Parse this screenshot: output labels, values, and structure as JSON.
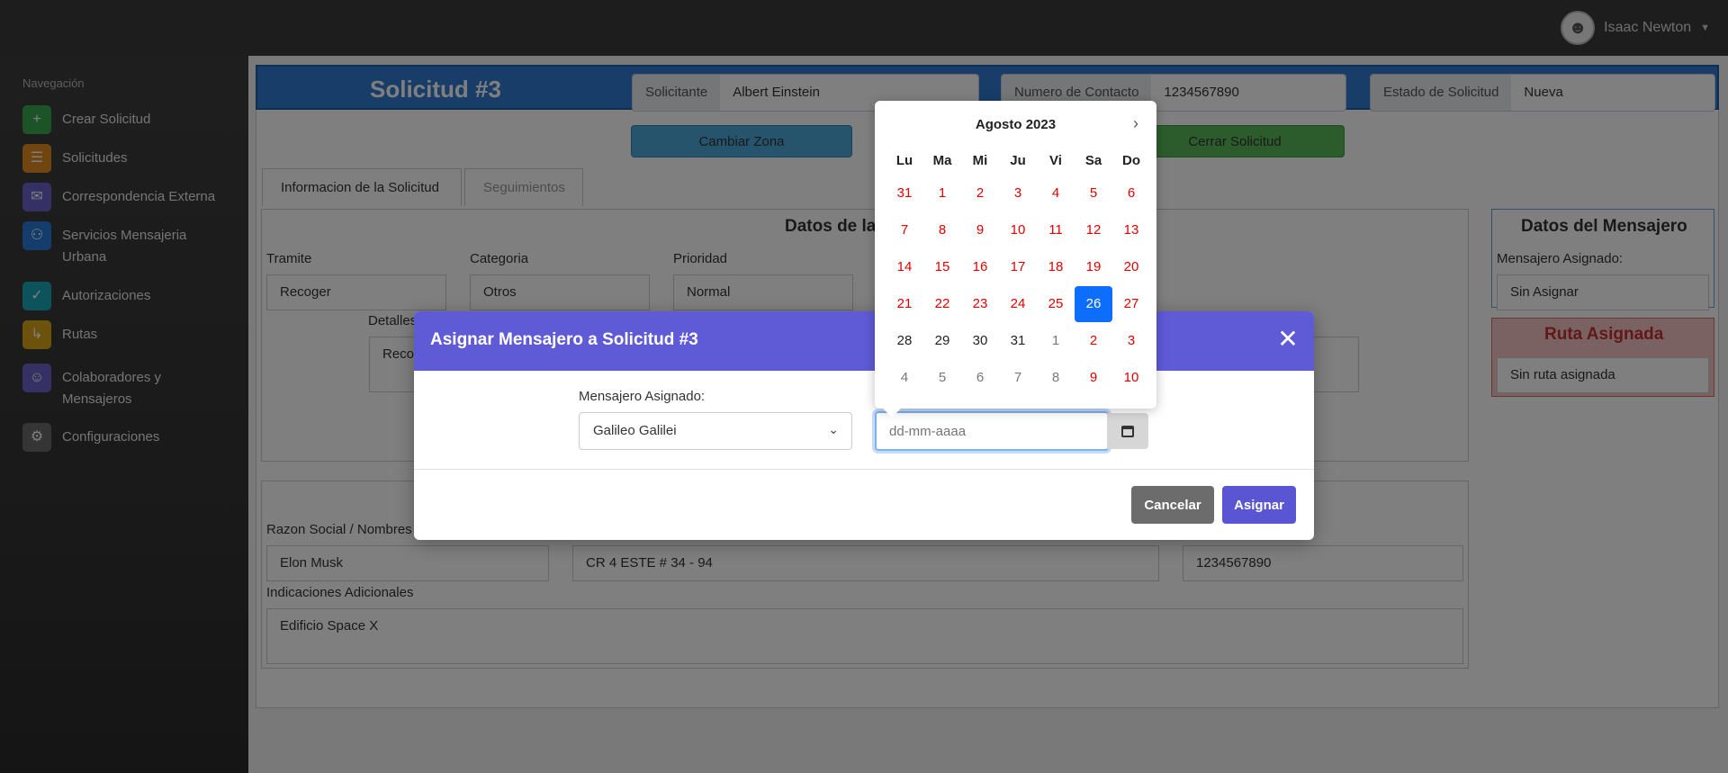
{
  "header": {
    "user_name": "Isaac Newton"
  },
  "sidebar": {
    "title": "Navegación",
    "items": [
      {
        "label": "Crear Solicitud",
        "icon": "document-plus-icon",
        "color": "#38a850"
      },
      {
        "label": "Solicitudes",
        "icon": "list-icon",
        "color": "#e08a1e"
      },
      {
        "label": "Correspondencia Externa",
        "icon": "envelope-icon",
        "color": "#6a63c9"
      },
      {
        "label": "Servicios Mensajeria Urbana",
        "icon": "motorcycle-icon",
        "color": "#2a7bd8"
      },
      {
        "label": "Autorizaciones",
        "icon": "clipboard-check-icon",
        "color": "#1aa6b8"
      },
      {
        "label": "Rutas",
        "icon": "route-icon",
        "color": "#d9a515"
      },
      {
        "label": "Colaboradores y Mensajeros",
        "icon": "users-icon",
        "color": "#6a63c9"
      },
      {
        "label": "Configuraciones",
        "icon": "gear-icon",
        "color": "#6b6b6b"
      }
    ]
  },
  "request": {
    "title": "Solicitud #3",
    "requester_label": "Solicitante",
    "requester_value": "Albert Einstein",
    "contact_label": "Numero de Contacto",
    "contact_value": "1234567890",
    "status_label": "Estado de Solicitud",
    "status_value": "Nueva",
    "change_zone": "Cambiar Zona",
    "close_request": "Cerrar Solicitud",
    "tabs": [
      "Informacion de la Solicitud",
      "Seguimientos"
    ],
    "data_title": "Datos de la",
    "tramite_label": "Tramite",
    "tramite_value": "Recoger",
    "categoria_label": "Categoria",
    "categoria_value": "Otros",
    "prioridad_label": "Prioridad",
    "prioridad_value": "Normal",
    "detalles_label": "Detalles",
    "detalles_value": "Reco",
    "razon_label": "Razon Social / Nombres",
    "razon_value": "Elon Musk",
    "direccion_value": "CR 4 ESTE # 34 - 94",
    "telefono_value": "1234567890",
    "indicaciones_label": "Indicaciones Adicionales",
    "indicaciones_value": "Edificio Space X",
    "courier_title": "Datos del Mensajero",
    "courier_label": "Mensajero Asignado:",
    "courier_value": "Sin Asignar",
    "route_title": "Ruta Asignada",
    "route_value": "Sin ruta asignada"
  },
  "modal": {
    "title": "Asignar Mensajero a Solicitud #3",
    "courier_label": "Mensajero Asignado:",
    "courier_selected": "Galileo Galilei",
    "date_placeholder": "dd-mm-aaaa",
    "cancel": "Cancelar",
    "assign": "Asignar"
  },
  "calendar": {
    "month_label": "Agosto 2023",
    "weekdays": [
      "Lu",
      "Ma",
      "Mi",
      "Ju",
      "Vi",
      "Sa",
      "Do"
    ],
    "weeks": [
      [
        "31",
        "1",
        "2",
        "3",
        "4",
        "5",
        "6"
      ],
      [
        "7",
        "8",
        "9",
        "10",
        "11",
        "12",
        "13"
      ],
      [
        "14",
        "15",
        "16",
        "17",
        "18",
        "19",
        "20"
      ],
      [
        "21",
        "22",
        "23",
        "24",
        "25",
        "26",
        "27"
      ],
      [
        "28",
        "29",
        "30",
        "31",
        "1",
        "2",
        "3"
      ],
      [
        "4",
        "5",
        "6",
        "7",
        "8",
        "9",
        "10"
      ]
    ],
    "selected_day": "26",
    "highlight_color": "#0d6efd",
    "disabled_color": "#e00000"
  }
}
